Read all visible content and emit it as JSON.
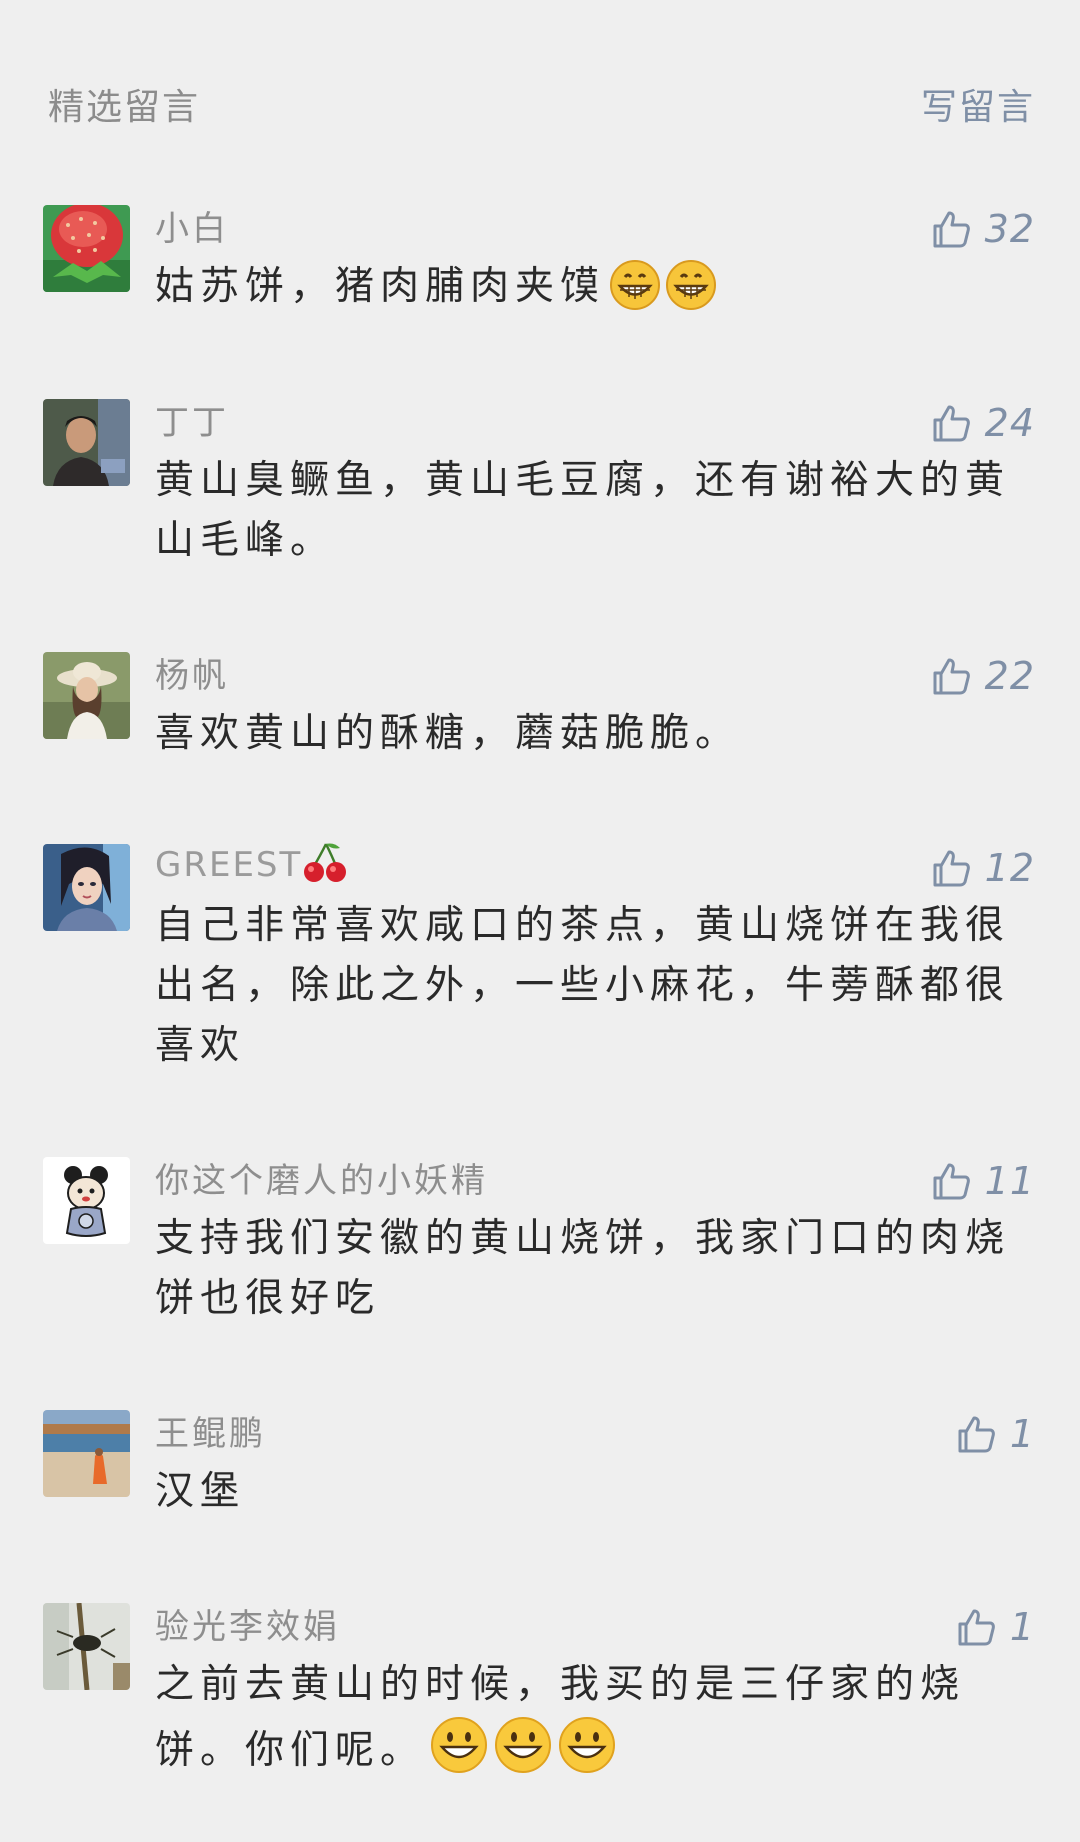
{
  "header": {
    "title": "精选留言",
    "write_comment": "写留言"
  },
  "comments": [
    {
      "name": "小白",
      "likes": "32",
      "text": "姑苏饼，猪肉脯肉夹馍",
      "emojis": [
        "grinning",
        "grinning"
      ]
    },
    {
      "name": "丁丁",
      "likes": "24",
      "text": "黄山臭鳜鱼，黄山毛豆腐，还有谢裕大的黄山毛峰。",
      "emojis": []
    },
    {
      "name": "杨帆",
      "likes": "22",
      "text": "喜欢黄山的酥糖，蘑菇脆脆。",
      "emojis": []
    },
    {
      "name": "GREEST",
      "name_emoji": "cherries",
      "likes": "12",
      "text": "自己非常喜欢咸口的茶点，黄山烧饼在我很出名，除此之外，一些小麻花，牛蒡酥都很喜欢",
      "emojis": []
    },
    {
      "name": "你这个磨人的小妖精",
      "likes": "11",
      "text": "支持我们安徽的黄山烧饼，我家门口的肉烧饼也很好吃",
      "emojis": []
    },
    {
      "name": "王鲲鹏",
      "likes": "1",
      "text": "汉堡",
      "emojis": []
    },
    {
      "name": "验光李效娟",
      "likes": "1",
      "text": "之前去黄山的时候，我买的是三仔家的烧饼。你们呢。",
      "emojis": [
        "smile",
        "smile",
        "smile"
      ]
    }
  ],
  "colors": {
    "background": "#efefef",
    "link": "#7f8fa6",
    "name": "#8e8e8e",
    "text": "#2a2a2a"
  }
}
